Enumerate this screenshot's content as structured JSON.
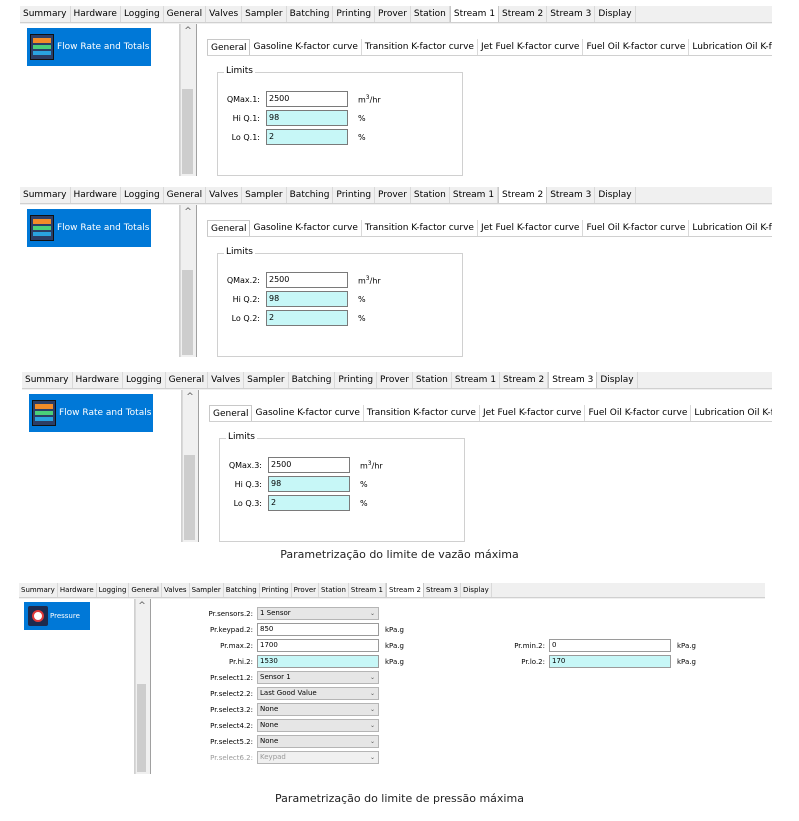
{
  "main_tabs": [
    "Summary",
    "Hardware",
    "Logging",
    "General",
    "Valves",
    "Sampler",
    "Batching",
    "Printing",
    "Prover",
    "Station",
    "Stream 1",
    "Stream 2",
    "Stream 3",
    "Display"
  ],
  "sub_tabs": [
    "General",
    "Gasoline K-factor curve",
    "Transition K-factor curve",
    "Jet Fuel K-factor curve",
    "Fuel Oil K-factor curve",
    "Lubrication Oil K-factor curve"
  ],
  "tree_item_flow": "Flow Rate and Totals",
  "limits_title": "Limits",
  "unit_flow_base": "m",
  "unit_flow_sup": "3",
  "unit_flow_rest": "/hr",
  "unit_pct": "%",
  "stream1": {
    "active_tab": "Stream 1",
    "qmax_label": "QMax.1:",
    "qmax": "2500",
    "hiq_label": "Hi Q.1:",
    "hiq": "98",
    "loq_label": "Lo Q.1:",
    "loq": "2"
  },
  "stream2": {
    "active_tab": "Stream 2",
    "qmax_label": "QMax.2:",
    "qmax": "2500",
    "hiq_label": "Hi Q.2:",
    "hiq": "98",
    "loq_label": "Lo Q.2:",
    "loq": "2"
  },
  "stream3": {
    "active_tab": "Stream 3",
    "qmax_label": "QMax.3:",
    "qmax": "2500",
    "hiq_label": "Hi Q.3:",
    "hiq": "98",
    "loq_label": "Lo Q.3:",
    "loq": "2"
  },
  "caption_flow": "Parametrização do limite de vazão máxima",
  "pressure": {
    "active_tab": "Stream 2",
    "tree_item": "Pressure",
    "sensors_label": "Pr.sensors.2:",
    "sensors": "1 Sensor",
    "keypad_label": "Pr.keypad.2:",
    "keypad": "850",
    "max_label": "Pr.max.2:",
    "max": "1700",
    "hi_label": "Pr.hi.2:",
    "hi": "1530",
    "min_label": "Pr.min.2:",
    "min": "0",
    "lo_label": "Pr.lo.2:",
    "lo": "170",
    "unit": "kPa.g",
    "select1_label": "Pr.select1.2:",
    "select1": "Sensor 1",
    "select2_label": "Pr.select2.2:",
    "select2": "Last Good Value",
    "select3_label": "Pr.select3.2:",
    "select3": "None",
    "select4_label": "Pr.select4.2:",
    "select4": "None",
    "select5_label": "Pr.select5.2:",
    "select5": "None",
    "select6_label": "Pr.select6.2:",
    "select6": "Keypad"
  },
  "caption_pressure": "Parametrização do limite de pressão máxima"
}
